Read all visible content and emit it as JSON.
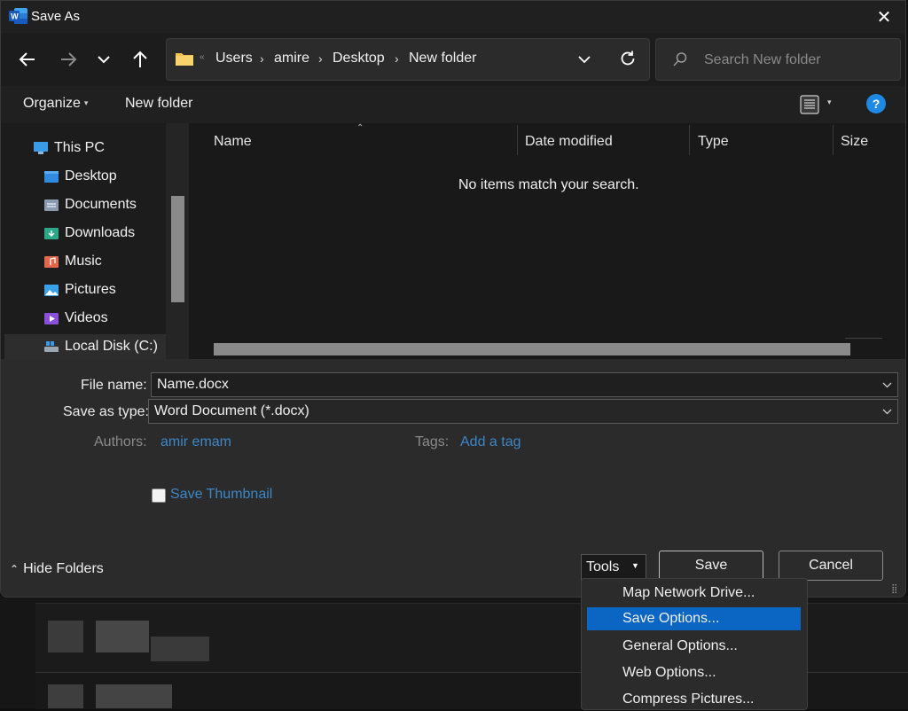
{
  "window": {
    "title": "Save As",
    "app_icon": "word-icon",
    "close_glyph": "✕"
  },
  "nav": {
    "back_glyph": "←",
    "forward_glyph": "→",
    "recent_glyph": "⌄",
    "up_glyph": "↑",
    "breadcrumbs": [
      "Users",
      "amire",
      "Desktop",
      "New folder"
    ],
    "refresh_glyph": "↻",
    "search_placeholder": "Search New folder"
  },
  "toolbar": {
    "organize_label": "Organize",
    "new_folder_label": "New folder",
    "help_glyph": "?"
  },
  "sidebar": {
    "items": [
      {
        "label": "This PC",
        "icon": "this-pc-icon",
        "color": "#3a9be8"
      },
      {
        "label": "Desktop",
        "icon": "desktop-folder-icon",
        "color": "#2f8ae0"
      },
      {
        "label": "Documents",
        "icon": "documents-folder-icon",
        "color": "#8a9bb0"
      },
      {
        "label": "Downloads",
        "icon": "downloads-folder-icon",
        "color": "#2aa889"
      },
      {
        "label": "Music",
        "icon": "music-folder-icon",
        "color": "#e0684c"
      },
      {
        "label": "Pictures",
        "icon": "pictures-folder-icon",
        "color": "#3aa0e8"
      },
      {
        "label": "Videos",
        "icon": "videos-folder-icon",
        "color": "#8a4fd8"
      },
      {
        "label": "Local Disk (C:)",
        "icon": "local-disk-icon",
        "color": "#9aa6b2"
      }
    ]
  },
  "file_list": {
    "columns": [
      "Name",
      "Date modified",
      "Type",
      "Size"
    ],
    "empty_message": "No items match your search."
  },
  "form": {
    "file_name_label": "File name:",
    "file_name_value": "Name.docx",
    "save_type_label": "Save as type:",
    "save_type_value": "Word Document (*.docx)",
    "authors_label": "Authors:",
    "authors_value": "amir emam",
    "tags_label": "Tags:",
    "tags_value": "Add a tag",
    "thumbnail_label": "Save Thumbnail"
  },
  "footer": {
    "hide_folders_label": "Hide Folders",
    "tools_label": "Tools",
    "save_label": "Save",
    "cancel_label": "Cancel"
  },
  "tools_menu": {
    "items": [
      "Map Network Drive...",
      "Save Options...",
      "General Options...",
      "Web Options...",
      "Compress Pictures..."
    ],
    "selected_index": 1
  },
  "colors": {
    "accent": "#0a66c2",
    "link": "#3c87c7",
    "folder": "#f2c14e"
  }
}
